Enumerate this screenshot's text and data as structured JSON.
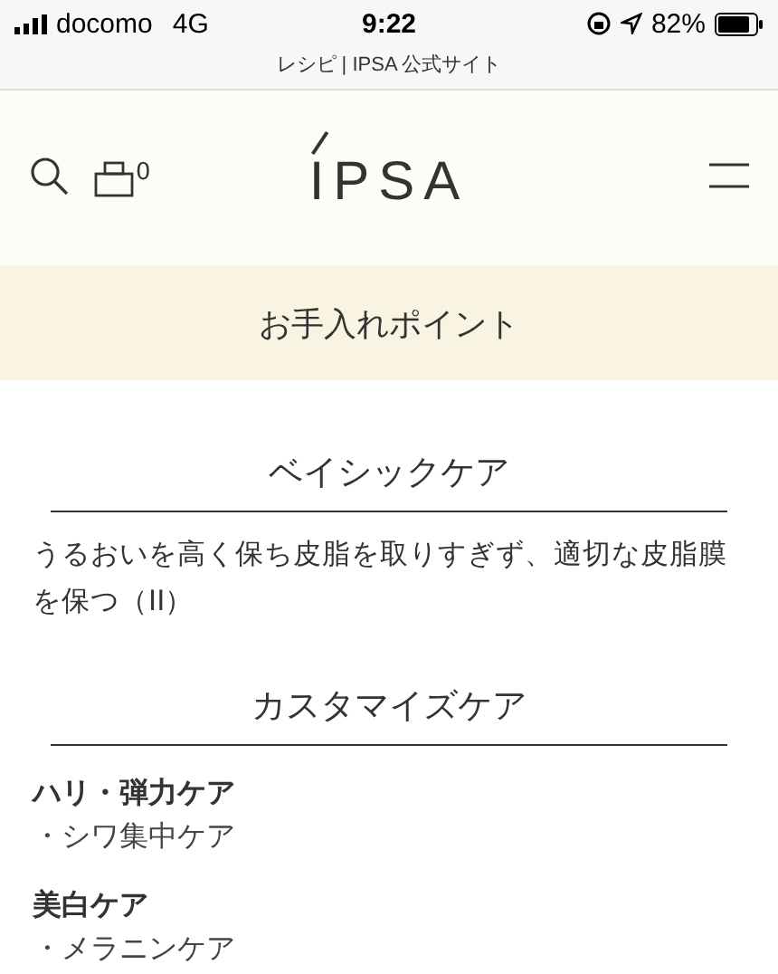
{
  "status_bar": {
    "carrier": "docomo",
    "network": "4G",
    "time": "9:22",
    "battery": "82%"
  },
  "browser": {
    "title": "レシピ | IPSA 公式サイト"
  },
  "header": {
    "logo": "IPSA",
    "cart_count": "0"
  },
  "banner": {
    "title": "お手入れポイント"
  },
  "sections": [
    {
      "heading": "ベイシックケア",
      "text": "うるおいを高く保ち皮脂を取りすぎず、適切な皮脂膜を保つ（II）"
    },
    {
      "heading": "カスタマイズケア",
      "groups": [
        {
          "title": "ハリ・弾力ケア",
          "points": [
            "・シワ集中ケア"
          ]
        },
        {
          "title": "美白ケア",
          "points": [
            "・メラニンケア"
          ]
        }
      ]
    }
  ]
}
